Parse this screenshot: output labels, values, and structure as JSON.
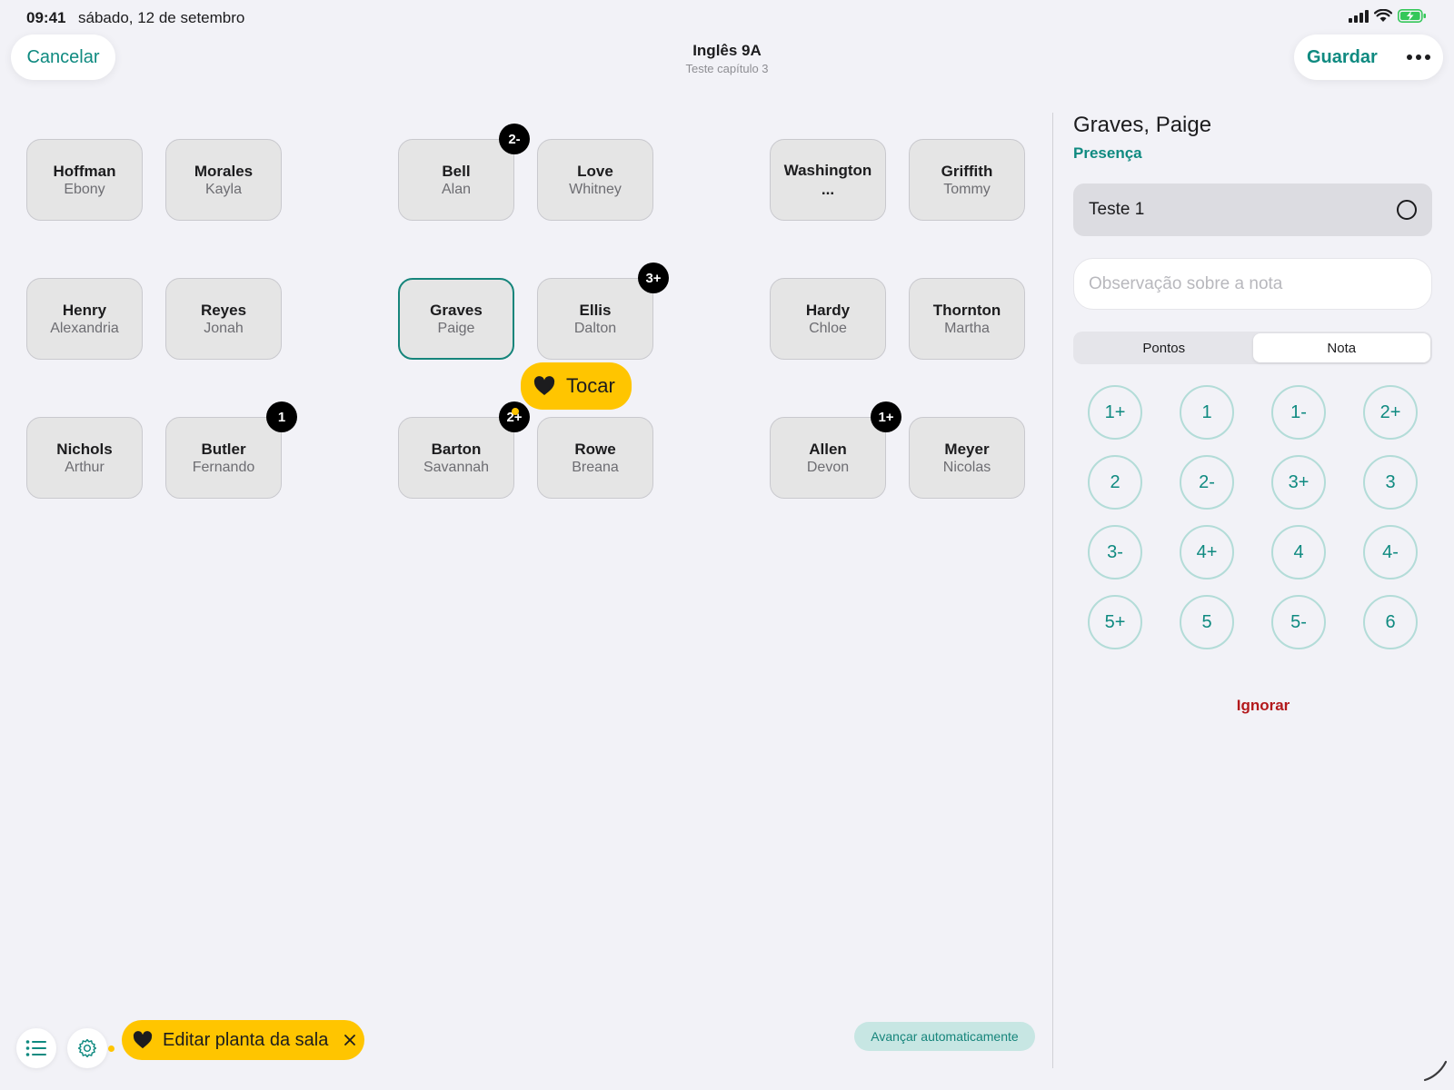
{
  "status_bar": {
    "time": "09:41",
    "date": "sábado, 12 de setembro"
  },
  "header": {
    "cancel_label": "Cancelar",
    "title": "Inglês 9A",
    "subtitle": "Teste capítulo 3",
    "save_label": "Guardar"
  },
  "seats": [
    {
      "last": "Hoffman",
      "first": "Ebony"
    },
    {
      "last": "Morales",
      "first": "Kayla"
    },
    {
      "last": "Bell",
      "first": "Alan",
      "badge": "2-"
    },
    {
      "last": "Love",
      "first": "Whitney"
    },
    {
      "last": "Washington...",
      "first": ""
    },
    {
      "last": "Griffith",
      "first": "Tommy"
    },
    {
      "last": "Henry",
      "first": "Alexandria"
    },
    {
      "last": "Reyes",
      "first": "Jonah"
    },
    {
      "last": "Graves",
      "first": "Paige",
      "selected": true
    },
    {
      "last": "Ellis",
      "first": "Dalton",
      "badge": "3+"
    },
    {
      "last": "Hardy",
      "first": "Chloe"
    },
    {
      "last": "Thornton",
      "first": "Martha"
    },
    {
      "last": "Nichols",
      "first": "Arthur"
    },
    {
      "last": "Butler",
      "first": "Fernando",
      "badge": "1"
    },
    {
      "last": "Barton",
      "first": "Savannah",
      "badge": "2+"
    },
    {
      "last": "Rowe",
      "first": "Breana"
    },
    {
      "last": "Allen",
      "first": "Devon",
      "badge": "1+"
    },
    {
      "last": "Meyer",
      "first": "Nicolas"
    }
  ],
  "tip_tap": {
    "label": "Tocar"
  },
  "panel": {
    "student_name": "Graves, Paige",
    "attendance_label": "Presença",
    "test_label": "Teste 1",
    "note_placeholder": "Observação sobre a nota",
    "segments": [
      "Pontos",
      "Nota"
    ],
    "active_segment": "Nota",
    "grades": [
      "1+",
      "1",
      "1-",
      "2+",
      "2",
      "2-",
      "3+",
      "3",
      "3-",
      "4+",
      "4",
      "4-",
      "5+",
      "5",
      "5-",
      "6"
    ],
    "ignore_label": "Ignorar"
  },
  "footer": {
    "edit_tip_label": "Editar planta da sala",
    "auto_advance_label": "Avançar automaticamente"
  },
  "colors": {
    "accent": "#0f8a80",
    "tip_yellow": "#ffc500",
    "danger": "#b3191c",
    "background": "#f2f2f7"
  }
}
